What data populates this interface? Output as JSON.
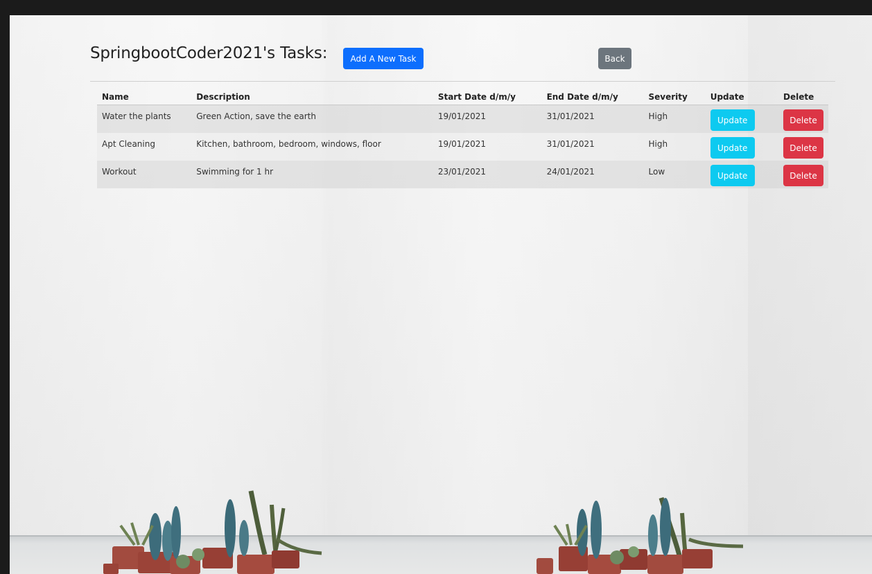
{
  "page": {
    "title": "SpringbootCoder2021's Tasks:",
    "add_button": "Add A New Task",
    "back_button": "Back"
  },
  "table": {
    "columns": [
      "Name",
      "Description",
      "Start Date d/m/y",
      "End Date d/m/y",
      "Severity",
      "Update",
      "Delete"
    ],
    "rows": [
      {
        "name": "Water the plants",
        "description": "Green Action, save the earth",
        "start": "19/01/2021",
        "end": "31/01/2021",
        "severity": "High",
        "update_label": "Update",
        "delete_label": "Delete"
      },
      {
        "name": "Apt Cleaning",
        "description": "Kitchen, bathroom, bedroom, windows, floor",
        "start": "19/01/2021",
        "end": "31/01/2021",
        "severity": "High",
        "update_label": "Update",
        "delete_label": "Delete"
      },
      {
        "name": "Workout",
        "description": "Swimming for 1 hr",
        "start": "23/01/2021",
        "end": "24/01/2021",
        "severity": "Low",
        "update_label": "Update",
        "delete_label": "Delete"
      }
    ]
  },
  "colors": {
    "primary": "#0d6efd",
    "secondary": "#6c757d",
    "info": "#0dcaf0",
    "danger": "#dc3545"
  },
  "icons": [
    "cactus-plant-icon",
    "potted-plant-icon"
  ]
}
